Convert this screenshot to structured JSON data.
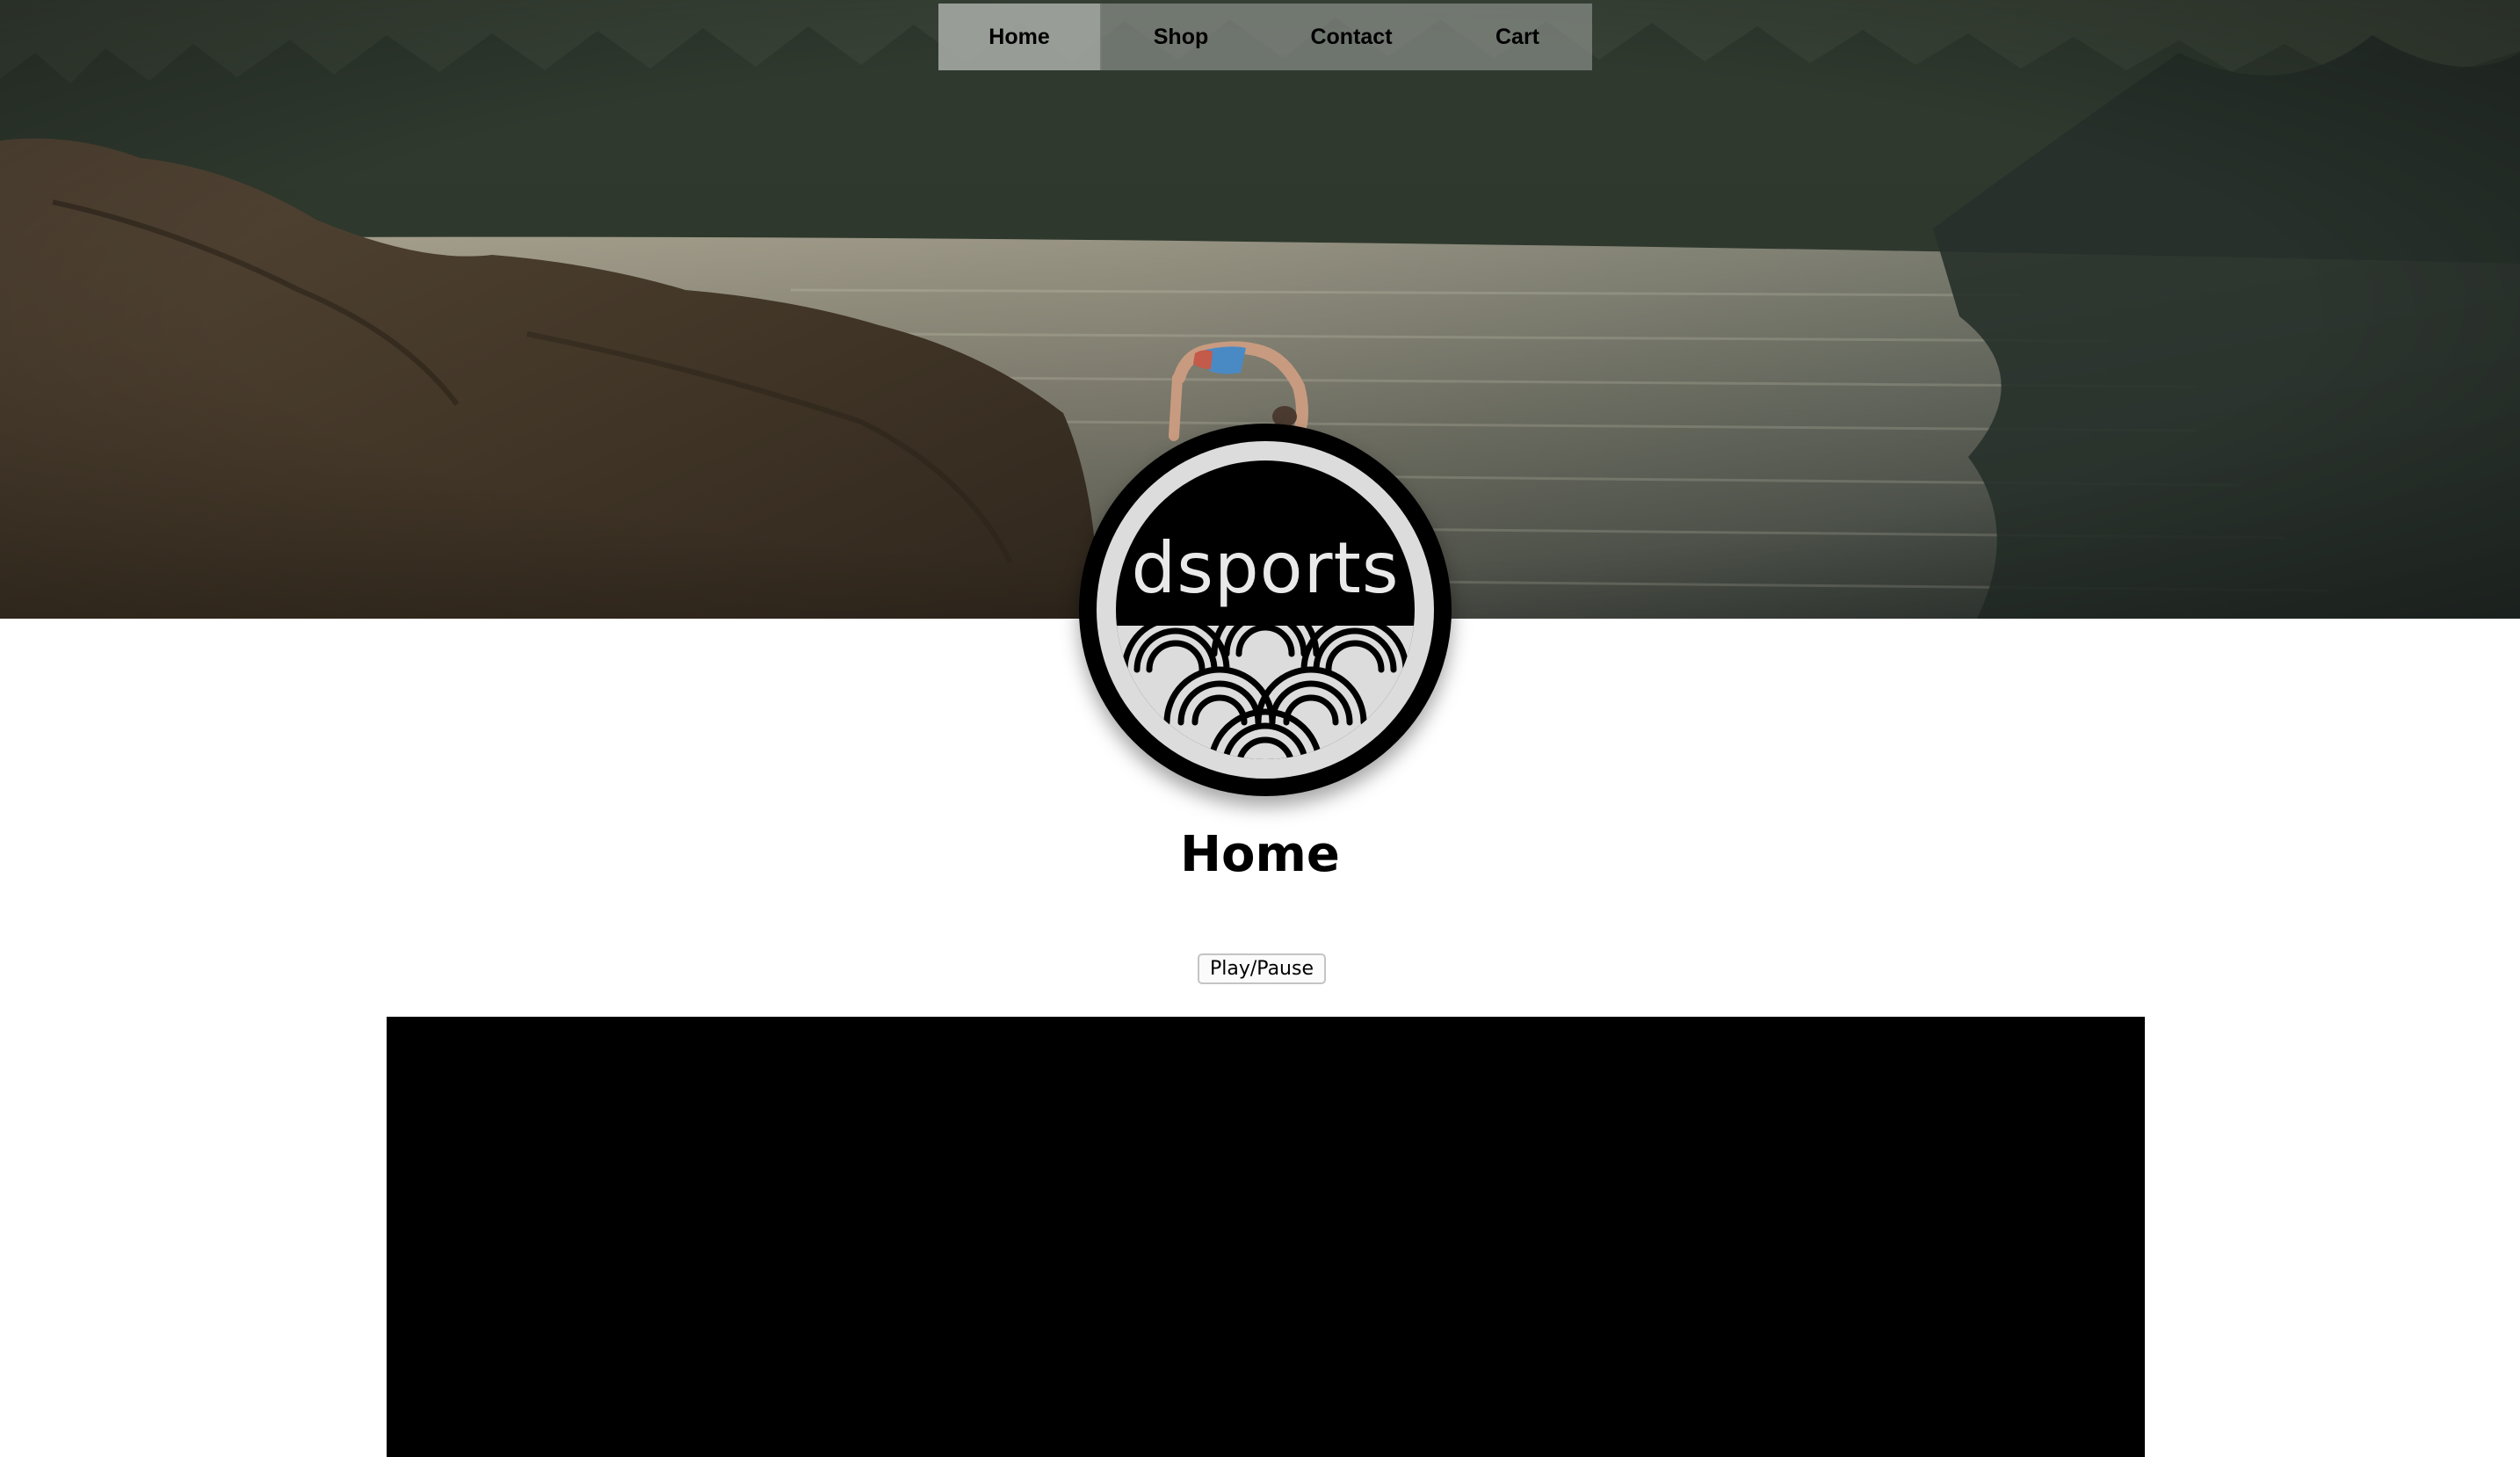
{
  "nav": {
    "items": [
      {
        "label": "Home",
        "active": true
      },
      {
        "label": "Shop",
        "active": false
      },
      {
        "label": "Contact",
        "active": false
      },
      {
        "label": "Cart",
        "active": false
      }
    ]
  },
  "hero": {
    "image": "lake-diver-photo"
  },
  "logo": {
    "text": "dsports",
    "icon": "waves-icon"
  },
  "main": {
    "title": "Home",
    "play_pause_label": "Play/Pause"
  },
  "video": {
    "state": "black"
  },
  "colors": {
    "nav_bg": "#9a9f9a",
    "logo_black": "#000000",
    "logo_gray": "#dcdcdc",
    "text": "#000000",
    "page_bg": "#ffffff"
  }
}
